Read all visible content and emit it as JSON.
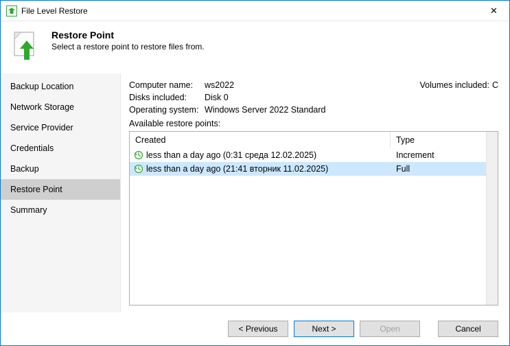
{
  "window": {
    "title": "File Level Restore",
    "close_glyph": "✕"
  },
  "banner": {
    "heading": "Restore Point",
    "subheading": "Select a restore point to restore files from."
  },
  "sidebar": {
    "items": [
      {
        "label": "Backup Location"
      },
      {
        "label": "Network Storage"
      },
      {
        "label": "Service Provider"
      },
      {
        "label": "Credentials"
      },
      {
        "label": "Backup"
      },
      {
        "label": "Restore Point"
      },
      {
        "label": "Summary"
      }
    ],
    "active_index": 5
  },
  "details": {
    "computer_name_label": "Computer name:",
    "computer_name_value": "ws2022",
    "disks_label": "Disks included:",
    "disks_value": "Disk 0",
    "os_label": "Operating system:",
    "os_value": "Windows Server 2022 Standard",
    "volumes_label": "Volumes included:",
    "volumes_value": "C",
    "available_label": "Available restore points:"
  },
  "table": {
    "columns": {
      "created": "Created",
      "type": "Type"
    },
    "rows": [
      {
        "created": "less than a day ago (0:31 среда 12.02.2025)",
        "type": "Increment"
      },
      {
        "created": "less than a day ago (21:41 вторник 11.02.2025)",
        "type": "Full"
      }
    ],
    "selected_index": 1
  },
  "footer": {
    "previous": "< Previous",
    "next": "Next >",
    "open": "Open",
    "cancel": "Cancel"
  }
}
